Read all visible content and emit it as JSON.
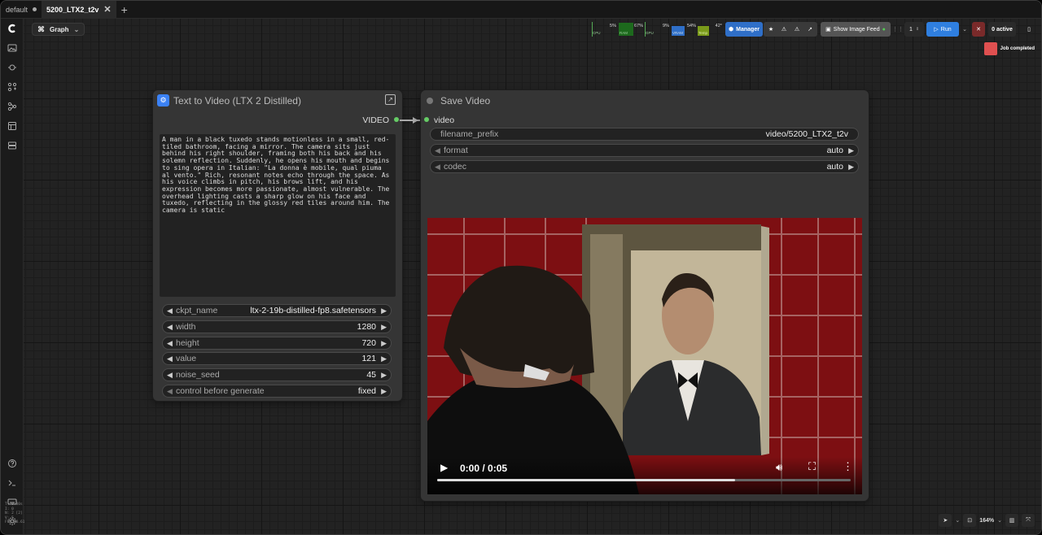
{
  "tabs": [
    {
      "label": "default",
      "active": false
    },
    {
      "label": "5200_LTX2_t2v",
      "active": true
    }
  ],
  "graph_label": "Graph",
  "meters": [
    {
      "label": "CPU",
      "value": "5%",
      "level": 0.05
    },
    {
      "label": "RAM",
      "value": "67%",
      "level": 0.67
    },
    {
      "label": "GPU",
      "value": "9%",
      "level": 0.09
    },
    {
      "label": "VRAM",
      "value": "54%",
      "level": 0.54
    },
    {
      "label": "Temp",
      "value": "42°",
      "level": 0.42
    }
  ],
  "toolbar": {
    "manager_label": "Manager",
    "image_feed_label": "Show Image Feed",
    "queue_count": "1",
    "run_label": "Run",
    "active_label": "0 active"
  },
  "job_status": "Job completed",
  "colors": {
    "accent": "#3b82f6",
    "status_badge": "#e05050",
    "run": "#2f7fe0"
  },
  "nodes": {
    "t2v": {
      "title": "Text to Video (LTX 2 Distilled)",
      "output_label": "VIDEO",
      "prompt": "A man in a black tuxedo stands motionless in a small, red-tiled bathroom, facing a mirror. The camera sits just behind his right shoulder, framing both his back and his solemn reflection. Suddenly, he opens his mouth and begins to sing opera in Italian: \"La donna è mobile, qual piuma al vento.\" Rich, resonant notes echo through the space. As his voice climbs in pitch, his brows lift, and his expression becomes more passionate, almost vulnerable. The overhead lighting casts a sharp glow on his face and tuxedo, reflecting in the glossy red tiles around him. The camera is static",
      "widgets": [
        {
          "name": "ckpt_name",
          "value": "ltx-2-19b-distilled-fp8.safetensors"
        },
        {
          "name": "width",
          "value": "1280"
        },
        {
          "name": "height",
          "value": "720"
        },
        {
          "name": "value",
          "value": "121"
        },
        {
          "name": "noise_seed",
          "value": "45"
        },
        {
          "name": "control before generate",
          "value": "fixed"
        }
      ]
    },
    "save": {
      "title": "Save Video",
      "input_label": "video",
      "widgets": [
        {
          "name": "filename_prefix",
          "value": "video/5200_LTX2_t2v"
        },
        {
          "name": "format",
          "value": "auto"
        },
        {
          "name": "codec",
          "value": "auto"
        }
      ],
      "video_time": "0:00 / 0:05",
      "progress": 0.72
    }
  },
  "zoom": "164%",
  "stats": [
    "T: 0.00s",
    "I: 0",
    "N: 2 [2]",
    "V: 5",
    "FPS:60.61"
  ]
}
